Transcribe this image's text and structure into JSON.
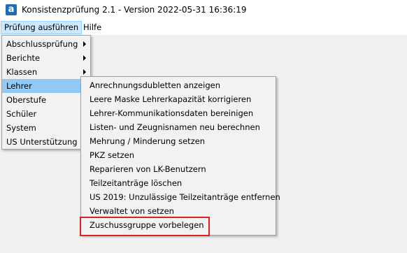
{
  "window": {
    "title": "Konsistenzprüfung 2.1 - Version 2022-05-31 16:36:19",
    "icon": "app-icon-a"
  },
  "menubar": {
    "items": [
      {
        "label": "Prüfung ausführen",
        "open": true
      },
      {
        "label": "Hilfe",
        "open": false
      }
    ]
  },
  "main_menu": {
    "items": [
      {
        "label": "Abschlussprüfung",
        "has_submenu": true
      },
      {
        "label": "Berichte",
        "has_submenu": true
      },
      {
        "label": "Klassen",
        "has_submenu": true
      },
      {
        "label": "Lehrer",
        "has_submenu": true,
        "active": true
      },
      {
        "label": "Oberstufe",
        "has_submenu": true
      },
      {
        "label": "Schüler",
        "has_submenu": true
      },
      {
        "label": "System",
        "has_submenu": true
      },
      {
        "label": "US Unterstützung",
        "has_submenu": true
      }
    ]
  },
  "lehrer_submenu": {
    "items": [
      {
        "label": "Anrechnungsdubletten anzeigen"
      },
      {
        "label": "Leere Maske Lehrerkapazität korrigieren"
      },
      {
        "label": "Lehrer-Kommunikationsdaten bereinigen"
      },
      {
        "label": "Listen- und Zeugnisnamen neu berechnen"
      },
      {
        "label": "Mehrung / Minderung setzen"
      },
      {
        "label": "PKZ setzen"
      },
      {
        "label": "Reparieren von LK-Benutzern"
      },
      {
        "label": "Teilzeitanträge löschen"
      },
      {
        "label": "US 2019: Unzulässige Teilzeitanträge entfernen"
      },
      {
        "label": "Verwaltet von setzen"
      },
      {
        "label": "Zuschussgruppe vorbelegen",
        "highlighted": true
      }
    ]
  },
  "colors": {
    "highlight_border": "#e02020",
    "hover_background": "#91c9f7",
    "menu_background": "#f2f2f2"
  }
}
